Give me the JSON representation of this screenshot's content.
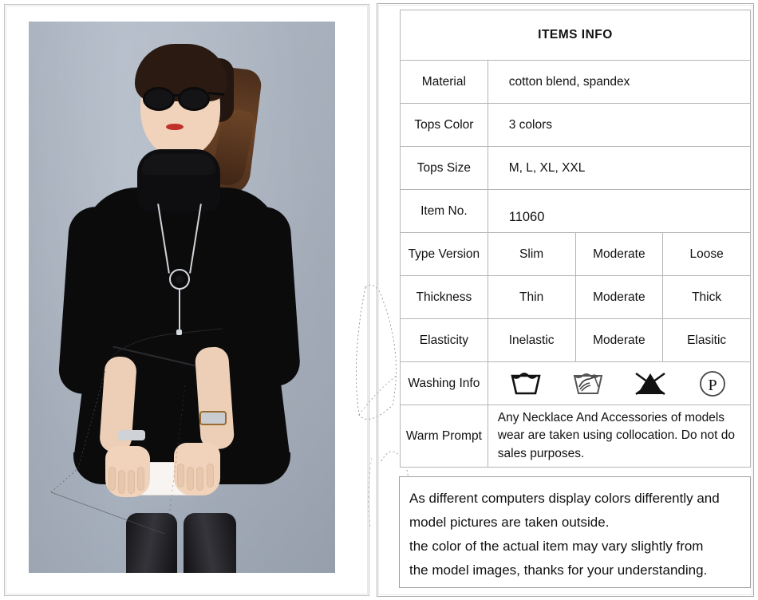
{
  "product_photo": {
    "alt": "Model wearing black turtleneck long-sleeve tunic top with sunglasses, necklace and black leggings, holding a white clutch",
    "background_color": "#aeb7c4",
    "garment_color": "#0b0b0c"
  },
  "info_table": {
    "title": "ITEMS INFO",
    "rows": [
      {
        "label": "Material",
        "value": "cotton blend, spandex"
      },
      {
        "label": "Tops Color",
        "value": "3 colors"
      },
      {
        "label": "Tops Size",
        "value": "M, L, XL, XXL"
      },
      {
        "label": "Item No.",
        "value": "11060"
      }
    ],
    "option_rows": [
      {
        "label": "Type Version",
        "options": [
          "Slim",
          "Moderate",
          "Loose"
        ],
        "selected": "Moderate"
      },
      {
        "label": "Thickness",
        "options": [
          "Thin",
          "Moderate",
          "Thick"
        ],
        "selected": "Moderate"
      },
      {
        "label": "Elasticity",
        "options": [
          "Inelastic",
          "Moderate",
          "Elasitic"
        ],
        "selected": "Moderate"
      }
    ],
    "washing": {
      "label": "Washing Info",
      "icons": [
        {
          "name": "machine-wash-icon",
          "title": "Machine wash"
        },
        {
          "name": "hand-wash-icon",
          "title": "Hand wash"
        },
        {
          "name": "do-not-bleach-icon",
          "title": "Do not bleach"
        },
        {
          "name": "dry-clean-p-icon",
          "title": "Dry clean, any solvent except trichloroethylene"
        }
      ]
    },
    "warm_prompt": {
      "label": "Warm Prompt",
      "text": "Any Necklace And Accessories of models wear are taken using collocation. Do not do sales purposes."
    },
    "selected_cell_bg": "#000000",
    "selected_cell_fg": "#ffffff",
    "border_color": "#b5b5b5"
  },
  "disclaimer": {
    "line1": "As different computers display colors differently and",
    "line2": "model pictures are taken outside.",
    "line3": "the color of the actual item may vary slightly from",
    "line4": "the model images, thanks for your understanding."
  }
}
